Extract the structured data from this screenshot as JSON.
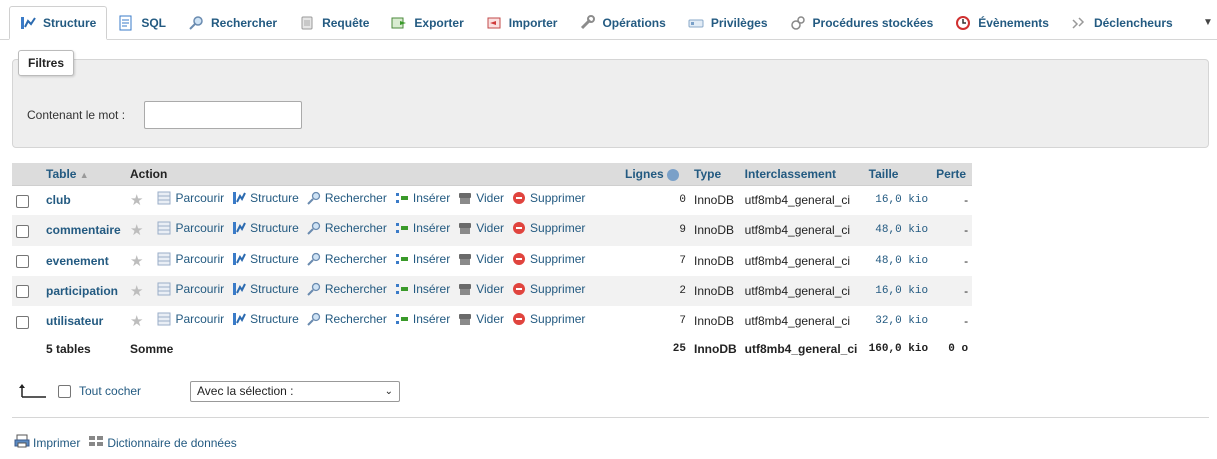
{
  "tabs": [
    {
      "label": "Structure",
      "icon": "structure-icon",
      "active": true
    },
    {
      "label": "SQL",
      "icon": "sql-icon"
    },
    {
      "label": "Rechercher",
      "icon": "search-icon"
    },
    {
      "label": "Requête",
      "icon": "query-icon"
    },
    {
      "label": "Exporter",
      "icon": "export-icon"
    },
    {
      "label": "Importer",
      "icon": "import-icon"
    },
    {
      "label": "Opérations",
      "icon": "wrench-icon"
    },
    {
      "label": "Privilèges",
      "icon": "privileges-icon"
    },
    {
      "label": "Procédures stockées",
      "icon": "routines-icon"
    },
    {
      "label": "Évènements",
      "icon": "clock-icon"
    },
    {
      "label": "Déclencheurs",
      "icon": "triggers-icon"
    }
  ],
  "filters": {
    "legend": "Filtres",
    "label": "Contenant le mot :",
    "value": ""
  },
  "headers": {
    "table": "Table",
    "action": "Action",
    "lignes": "Lignes",
    "type": "Type",
    "interclassement": "Interclassement",
    "taille": "Taille",
    "perte": "Perte"
  },
  "actions": {
    "browse": "Parcourir",
    "structure": "Structure",
    "search": "Rechercher",
    "insert": "Insérer",
    "empty": "Vider",
    "drop": "Supprimer"
  },
  "rows": [
    {
      "name": "club",
      "rows": "0",
      "type": "InnoDB",
      "collation": "utf8mb4_general_ci",
      "size": "16,0 kio",
      "overhead": "-"
    },
    {
      "name": "commentaire",
      "rows": "9",
      "type": "InnoDB",
      "collation": "utf8mb4_general_ci",
      "size": "48,0 kio",
      "overhead": "-"
    },
    {
      "name": "evenement",
      "rows": "7",
      "type": "InnoDB",
      "collation": "utf8mb4_general_ci",
      "size": "48,0 kio",
      "overhead": "-"
    },
    {
      "name": "participation",
      "rows": "2",
      "type": "InnoDB",
      "collation": "utf8mb4_general_ci",
      "size": "16,0 kio",
      "overhead": "-"
    },
    {
      "name": "utilisateur",
      "rows": "7",
      "type": "InnoDB",
      "collation": "utf8mb4_general_ci",
      "size": "32,0 kio",
      "overhead": "-"
    }
  ],
  "footer": {
    "count": "5 tables",
    "label": "Somme",
    "rows": "25",
    "type": "InnoDB",
    "collation": "utf8mb4_general_ci",
    "size": "160,0 kio",
    "overhead": "0 o"
  },
  "bulk": {
    "check_all": "Tout cocher",
    "with_selected": "Avec la sélection :"
  },
  "links": {
    "print": "Imprimer",
    "dictionary": "Dictionnaire de données"
  },
  "colors": {
    "link": "#235a81",
    "header_bg": "#dcdcdc",
    "row_alt": "#f2f2f2",
    "drop_red": "#e0443e"
  }
}
